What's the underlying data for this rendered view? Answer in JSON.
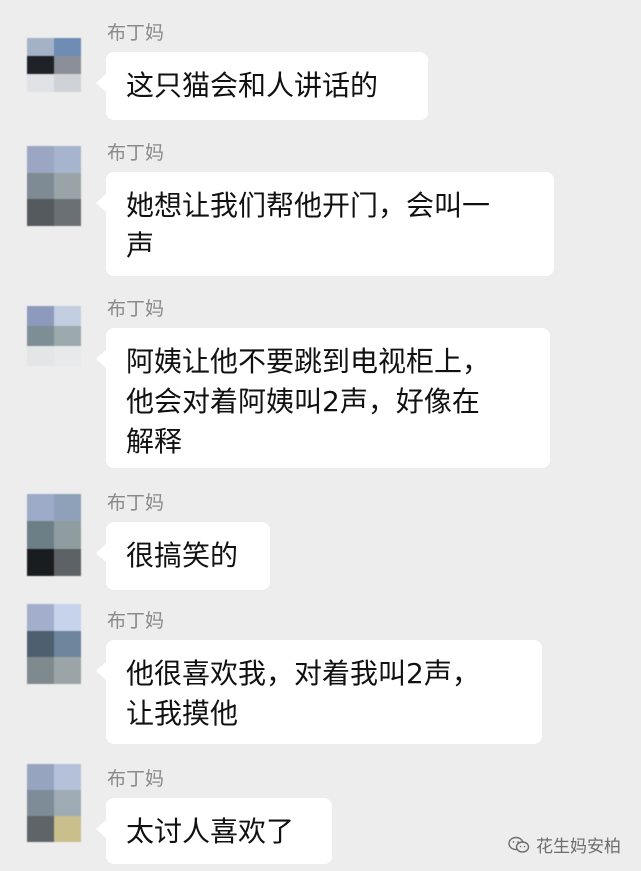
{
  "messages": [
    {
      "sender": "布丁妈",
      "text": "这只猫会和人讲话的",
      "avatar": [
        "#a4b2c8",
        "#6f8cb4",
        "#1e2128",
        "#8b9098",
        "#e0e2e6",
        "#cfd2d6"
      ]
    },
    {
      "sender": "布丁妈",
      "text": "她想让我们帮他开门，会叫一\n声",
      "avatar": [
        "#9aa6c2",
        "#a7b4cd",
        "#7e8a94",
        "#9aa4a8",
        "#545a5e",
        "#6a7074"
      ]
    },
    {
      "sender": "布丁妈",
      "text": "阿姨让他不要跳到电视柜上，\n他会对着阿姨叫2声，好像在\n解释",
      "avatar": [
        "#8d99bd",
        "#c2cde0",
        "#7d8e94",
        "#9ca9ad",
        "#e3e5e7",
        "#e8e9ea"
      ]
    },
    {
      "sender": "布丁妈",
      "text": "很搞笑的",
      "avatar": [
        "#9eabc8",
        "#8fa1b8",
        "#6c7e86",
        "#8f9ca0",
        "#1a1d20",
        "#5c6265"
      ]
    },
    {
      "sender": "布丁妈",
      "text": "他很喜欢我，对着我叫2声，\n让我摸他",
      "avatar": [
        "#a2aecb",
        "#c6d3ea",
        "#4e5f6f",
        "#6e859e",
        "#7e8a8e",
        "#9ba5a8"
      ]
    },
    {
      "sender": "布丁妈",
      "text": "太讨人喜欢了",
      "avatar": [
        "#97a4c0",
        "#b4c1d9",
        "#7d8c97",
        "#9eabb4",
        "#5e6468",
        "#c9bf8c"
      ]
    }
  ],
  "watermark": {
    "text": "花生妈安柏",
    "icon": "wechat-official-account-icon"
  }
}
